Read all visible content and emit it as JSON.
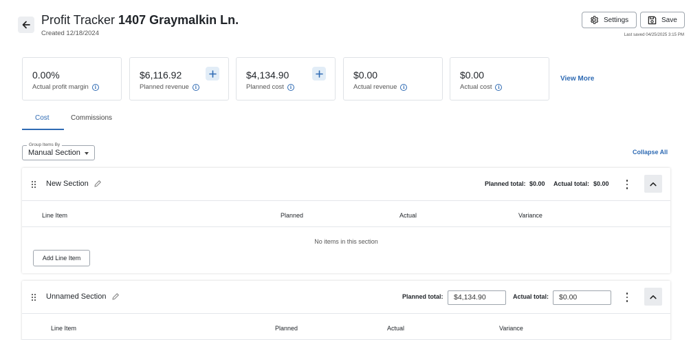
{
  "header": {
    "title_prefix": "Profit Tracker",
    "title_address": "1407 Graymalkin Ln.",
    "created": "Created 12/18/2024",
    "settings_label": "Settings",
    "save_label": "Save",
    "last_saved": "Last saved 04/25/2025 3:15 PM"
  },
  "summary": {
    "cards": [
      {
        "value": "0.00%",
        "label": "Actual profit margin"
      },
      {
        "value": "$6,116.92",
        "label": "Planned revenue"
      },
      {
        "value": "$4,134.90",
        "label": "Planned cost"
      },
      {
        "value": "$0.00",
        "label": "Actual revenue"
      },
      {
        "value": "$0.00",
        "label": "Actual cost"
      }
    ],
    "view_more": "View More"
  },
  "tabs": [
    {
      "label": "Cost",
      "active": true
    },
    {
      "label": "Commissions",
      "active": false
    }
  ],
  "grouping": {
    "legend": "Group Items By",
    "value": "Manual Section",
    "collapse_all": "Collapse All"
  },
  "columns": [
    "Line Item",
    "Planned",
    "Actual",
    "Variance"
  ],
  "sections": [
    {
      "name": "New Section",
      "planned_label": "Planned total:",
      "planned_total": "$0.00",
      "actual_label": "Actual total:",
      "actual_total": "$0.00",
      "empty_message": "No items in this section",
      "add_label": "Add Line Item"
    },
    {
      "name": "Unnamed Section",
      "planned_label": "Planned total:",
      "planned_total": "$4,134.90",
      "actual_label": "Actual total:",
      "actual_total": "$0.00"
    }
  ],
  "colors": {
    "accent": "#2e6ab3",
    "border": "#dfe2e6",
    "plus_bg": "#e2edf7"
  },
  "icons": [
    "arrow-left-icon",
    "gear-icon",
    "save-icon",
    "info-icon",
    "plus-icon",
    "drag-handle-icon",
    "pencil-icon",
    "more-vertical-icon",
    "chevron-up-icon"
  ]
}
